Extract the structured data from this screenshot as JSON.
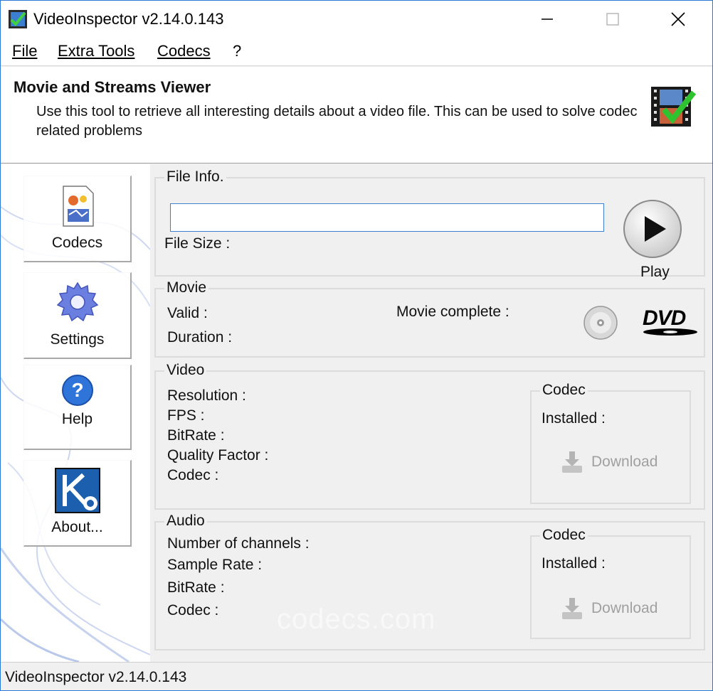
{
  "window": {
    "title": "VideoInspector v2.14.0.143"
  },
  "menu": {
    "file": "File",
    "extra_tools": "Extra Tools",
    "codecs": "Codecs",
    "help": "?"
  },
  "header": {
    "title": "Movie and Streams Viewer",
    "description": "Use this tool to retrieve all interesting details about a video file. This can be used to solve codec related problems"
  },
  "nav": {
    "codecs": "Codecs",
    "settings": "Settings",
    "help": "Help",
    "about": "About..."
  },
  "file_info": {
    "group_title": "File Info.",
    "path_value": "",
    "file_size_label": "File Size :",
    "play_label": "Play"
  },
  "movie": {
    "group_title": "Movie",
    "valid_label": "Valid :",
    "duration_label": "Duration :",
    "complete_label": "Movie complete :",
    "dvd_logo": "DVD"
  },
  "video": {
    "group_title": "Video",
    "resolution_label": "Resolution :",
    "fps_label": "FPS :",
    "bitrate_label": "BitRate :",
    "quality_label": "Quality Factor :",
    "codec_label": "Codec :",
    "codec_group_title": "Codec",
    "installed_label": "Installed :",
    "download_label": "Download"
  },
  "audio": {
    "group_title": "Audio",
    "channels_label": "Number of channels :",
    "sample_rate_label": "Sample Rate :",
    "bitrate_label": "BitRate :",
    "codec_label": "Codec :",
    "codec_group_title": "Codec",
    "installed_label": "Installed :",
    "download_label": "Download"
  },
  "watermark": "codecs.com",
  "status": {
    "text": "VideoInspector v2.14.0.143"
  },
  "colors": {
    "accent_border": "#2b79d4",
    "input_border": "#3c7fd0",
    "disabled_text": "#a0a0a0",
    "panel_bg": "#f0f0f0"
  },
  "icons": {
    "app": "check-film-icon",
    "header": "film-check-icon",
    "codecs": "codecs-document-icon",
    "settings": "gear-icon",
    "help": "question-icon",
    "about": "kc-logo-icon",
    "play": "play-icon",
    "cd": "cd-icon",
    "download": "download-icon"
  }
}
